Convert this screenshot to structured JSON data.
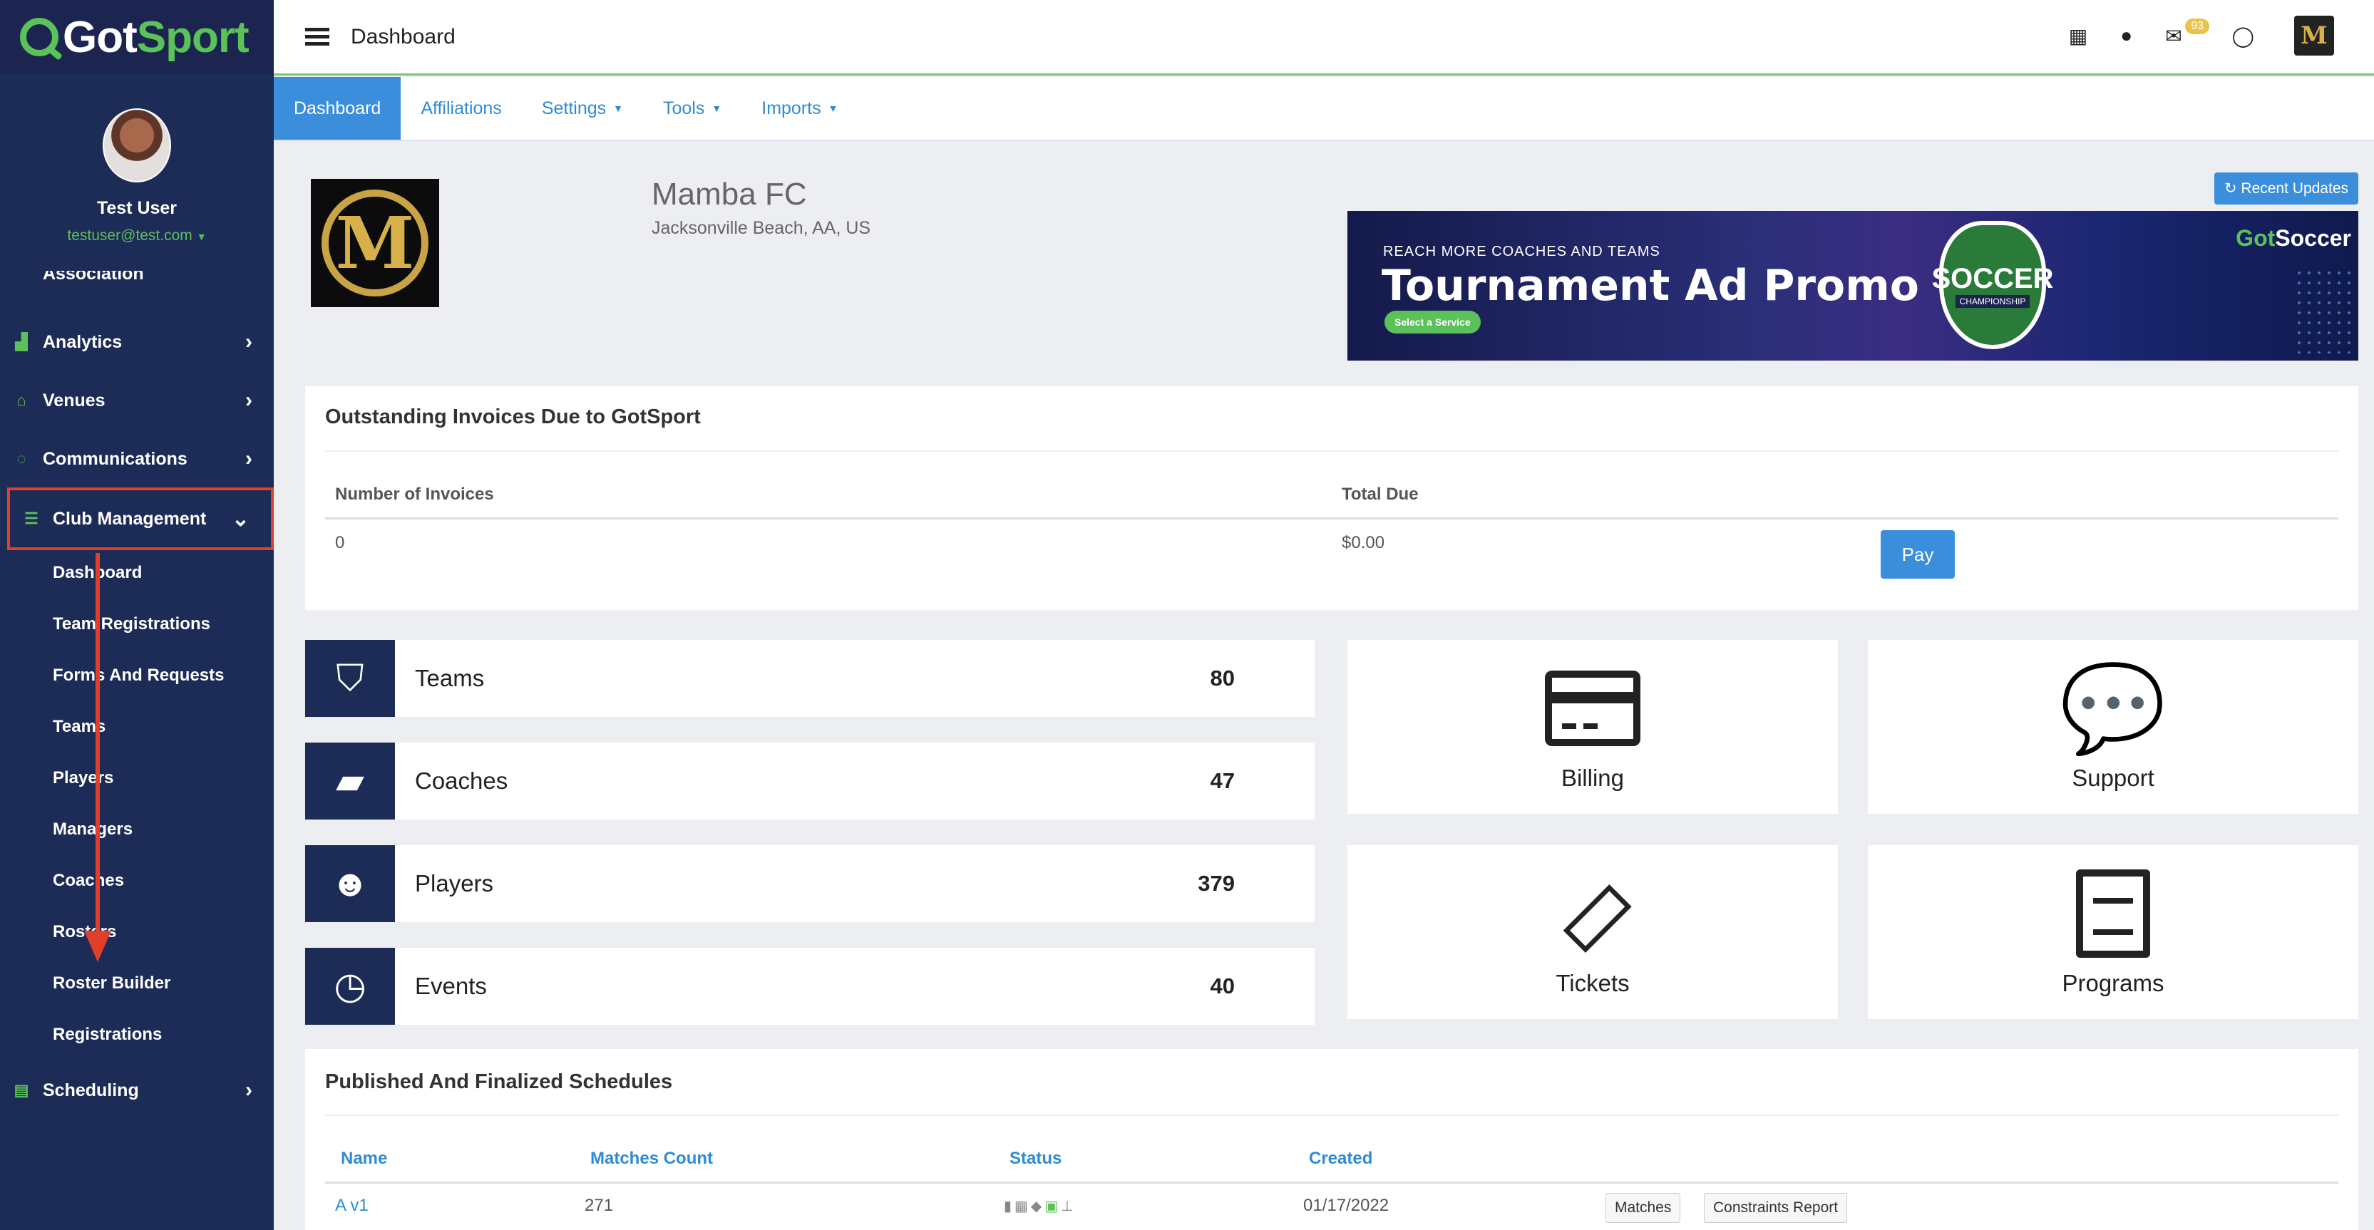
{
  "brand": {
    "got": "Got",
    "sport": "Sport"
  },
  "user": {
    "name": "Test User",
    "email": "testuser@test.com"
  },
  "sidebar": {
    "partial_item": "Association",
    "items": [
      {
        "label": "Analytics",
        "icon": "chart-icon"
      },
      {
        "label": "Venues",
        "icon": "home-icon"
      },
      {
        "label": "Communications",
        "icon": "chat-icon"
      },
      {
        "label": "Club Management",
        "icon": "list-icon"
      },
      {
        "label": "Scheduling",
        "icon": "calendar-icon"
      }
    ],
    "sub_items": [
      "Dashboard",
      "Team Registrations",
      "Forms And Requests",
      "Teams",
      "Players",
      "Managers",
      "Coaches",
      "Rosters",
      "Roster Builder",
      "Registrations"
    ]
  },
  "topbar": {
    "title": "Dashboard",
    "messages_badge": "93"
  },
  "subnav": {
    "tabs": [
      "Dashboard",
      "Affiliations",
      "Settings",
      "Tools",
      "Imports"
    ]
  },
  "club": {
    "name": "Mamba FC",
    "location": "Jacksonville Beach, AA, US",
    "logo_letter": "M"
  },
  "recent_updates": "Recent Updates",
  "banner": {
    "kicker": "REACH MORE COACHES AND TEAMS",
    "headline": "Tournament Ad Promo",
    "cta": "Select a Service",
    "badge_title": "SOCCER",
    "badge_sub": "CHAMPIONSHIP",
    "brand_got": "Got",
    "brand_soccer": "Soccer"
  },
  "invoices": {
    "title": "Outstanding Invoices Due to GotSport",
    "col_count": "Number of Invoices",
    "col_total": "Total Due",
    "count": "0",
    "total": "$0.00",
    "pay": "Pay"
  },
  "stats": [
    {
      "label": "Teams",
      "value": "80",
      "icon": "shield-icon"
    },
    {
      "label": "Coaches",
      "value": "47",
      "icon": "book-icon"
    },
    {
      "label": "Players",
      "value": "379",
      "icon": "users-icon"
    },
    {
      "label": "Events",
      "value": "40",
      "icon": "clock-icon"
    }
  ],
  "tiles": [
    {
      "label": "Billing",
      "icon": "credit-card-icon"
    },
    {
      "label": "Support",
      "icon": "chat-bubbles-icon"
    },
    {
      "label": "Tickets",
      "icon": "ticket-icon"
    },
    {
      "label": "Programs",
      "icon": "document-icon"
    }
  ],
  "schedules": {
    "title": "Published And Finalized Schedules",
    "headers": [
      "Name",
      "Matches Count",
      "Status",
      "Created"
    ],
    "rows": [
      {
        "name": "A v1",
        "matches": "271",
        "created": "01/17/2022",
        "btn1": "Matches",
        "btn2": "Constraints Report"
      }
    ]
  },
  "colors": {
    "sidebar": "#1d2b57",
    "accent": "#3b8edb",
    "brand_green": "#5bc25a",
    "highlight": "#e0402a"
  }
}
